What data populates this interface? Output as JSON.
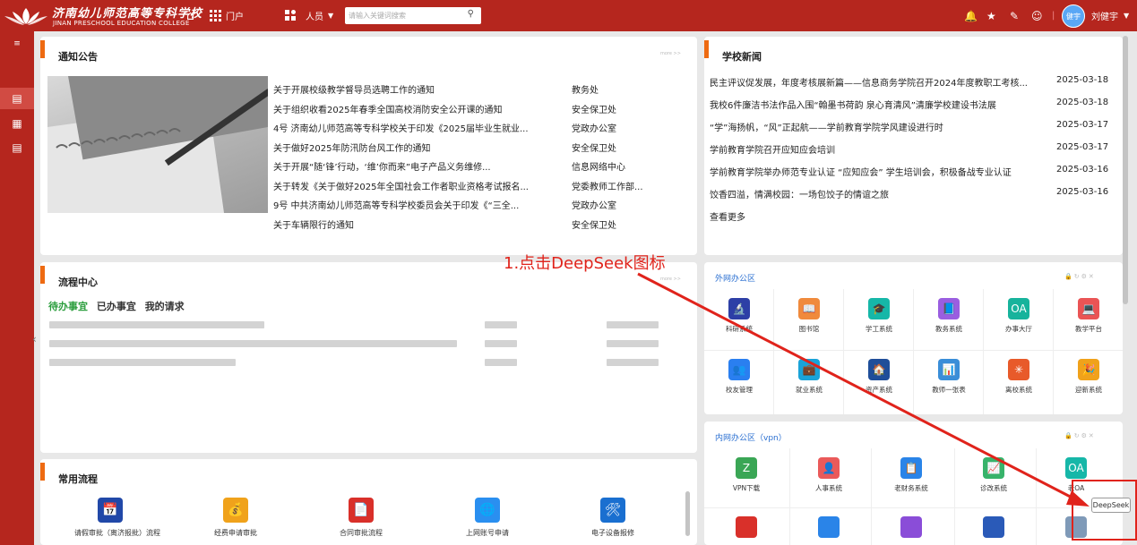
{
  "header": {
    "school_cn": "济南幼儿师范高等专科学校",
    "school_en": "JINAN PRESCHOOL EDUCATION COLLEGE",
    "home_icon": "home-icon",
    "portal_label": "门户",
    "scope_label": "人员",
    "search_placeholder": "请输入关键词搜索",
    "user_avatar": "健宇",
    "user_name": "刘健宇",
    "accent": "#b5261e"
  },
  "notice": {
    "title": "通知公告",
    "more": "more >>",
    "items": [
      {
        "title": "关于开展校级教学督导员选聘工作的通知",
        "dept": "教务处"
      },
      {
        "title": "关于组织收看2025年春季全国高校消防安全公开课的通知",
        "dept": "安全保卫处"
      },
      {
        "title": "4号 济南幼儿师范高等专科学校关于印发《2025届毕业生就业...",
        "dept": "党政办公室"
      },
      {
        "title": "关于做好2025年防汛防台风工作的通知",
        "dept": "安全保卫处"
      },
      {
        "title": "关于开展“随‘锋’行动，‘维’你而来”电子产品义务维修...",
        "dept": "信息网络中心"
      },
      {
        "title": "关于转发《关于做好2025年全国社会工作者职业资格考试报名...",
        "dept": "党委教师工作部..."
      },
      {
        "title": "9号 中共济南幼儿师范高等专科学校委员会关于印发《“三全...",
        "dept": "党政办公室"
      },
      {
        "title": "关于车辆限行的通知",
        "dept": "安全保卫处"
      }
    ]
  },
  "news": {
    "title": "学校新闻",
    "items": [
      {
        "title": "民主评议促发展，年度考核展新篇——信息商务学院召开2024年度教职工考核...",
        "date": "2025-03-18"
      },
      {
        "title": "我校6件廉洁书法作品入围“翰墨书荷韵 泉心育清风”清廉学校建设书法展",
        "date": "2025-03-18"
      },
      {
        "title": "“学”海扬帆，“风”正起航——学前教育学院学风建设进行时",
        "date": "2025-03-17"
      },
      {
        "title": "学前教育学院召开应知应会培训",
        "date": "2025-03-17"
      },
      {
        "title": "学前教育学院举办师范专业认证 “应知应会” 学生培训会，积极备战专业认证",
        "date": "2025-03-16"
      },
      {
        "title": "饺香四溢，情满校园：一场包饺子的情谊之旅",
        "date": "2025-03-16"
      }
    ],
    "view_more": "查看更多"
  },
  "process": {
    "title": "流程中心",
    "more": "more >>",
    "tabs": [
      "待办事宜",
      "已办事宜",
      "我的请求"
    ]
  },
  "common": {
    "title": "常用流程",
    "items": [
      {
        "label": "请假审批（离济报批）流程",
        "color": "#2148a8",
        "icon": "📅"
      },
      {
        "label": "经费申请审批",
        "color": "#f0a21b",
        "icon": "💰"
      },
      {
        "label": "合同审批流程",
        "color": "#d9302a",
        "icon": "📄"
      },
      {
        "label": "上网账号申请",
        "color": "#2a8ff0",
        "icon": "🌐"
      },
      {
        "label": "电子设备报修",
        "color": "#1a6fd0",
        "icon": "🛠"
      }
    ]
  },
  "external": {
    "title": "外网办公区",
    "apps": [
      {
        "label": "科研系统",
        "color": "#2d3fa6",
        "icon": "🔬"
      },
      {
        "label": "图书馆",
        "color": "#f08a3c",
        "icon": "📖"
      },
      {
        "label": "学工系统",
        "color": "#16b7a8",
        "icon": "🎓"
      },
      {
        "label": "教务系统",
        "color": "#9a5ee0",
        "icon": "📘"
      },
      {
        "label": "办事大厅",
        "color": "#17b39c",
        "icon": "OA"
      },
      {
        "label": "教学平台",
        "color": "#ea5455",
        "icon": "💻"
      },
      {
        "label": "校友管理",
        "color": "#2a7ff0",
        "icon": "👥"
      },
      {
        "label": "就业系统",
        "color": "#1aa3d8",
        "icon": "💼"
      },
      {
        "label": "资产系统",
        "color": "#1f4e99",
        "icon": "🏠"
      },
      {
        "label": "教师一张表",
        "color": "#3a8ed8",
        "icon": "📊"
      },
      {
        "label": "离校系统",
        "color": "#e85a2a",
        "icon": "✳"
      },
      {
        "label": "迎新系统",
        "color": "#f0a21b",
        "icon": "🎉"
      }
    ]
  },
  "internal": {
    "title": "内网办公区（vpn）",
    "apps": [
      {
        "label": "VPN下载",
        "color": "#3aa655",
        "icon": "Z"
      },
      {
        "label": "人事系统",
        "color": "#ea5a5a",
        "icon": "👤"
      },
      {
        "label": "老财务系统",
        "color": "#2a84e8",
        "icon": "📋"
      },
      {
        "label": "诊改系统",
        "color": "#37b36a",
        "icon": "📈"
      },
      {
        "label": "老OA",
        "color": "#16b7a8",
        "icon": "OA"
      }
    ],
    "row2_colors": [
      "#d9302a",
      "#2a84e8",
      "#8a4dd8",
      "#2a5ab8",
      "#7f9ab8"
    ]
  },
  "annotation": {
    "text": "1.点击DeepSeek图标",
    "color": "#e0231b"
  },
  "deepseek": {
    "label": "DeepSeek"
  }
}
